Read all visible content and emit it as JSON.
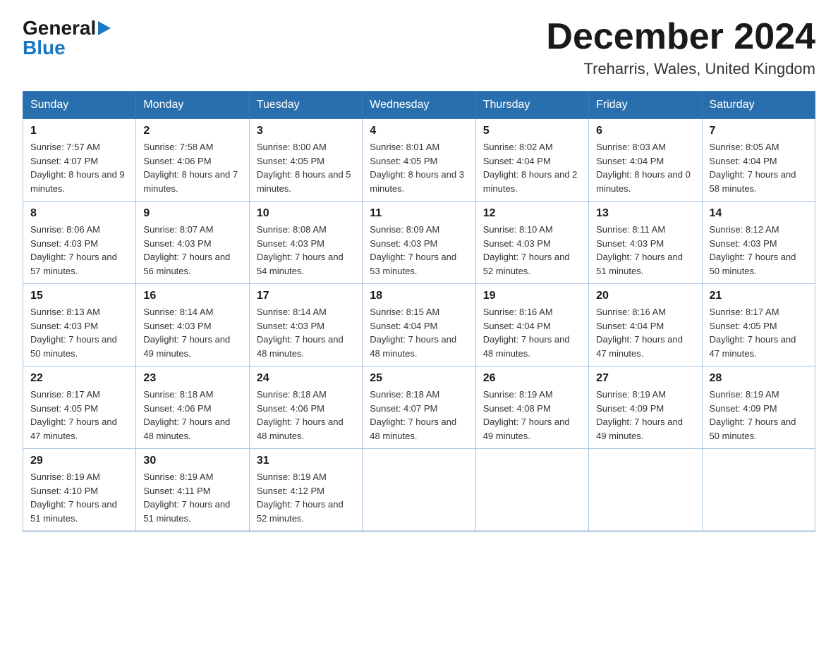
{
  "header": {
    "logo_general": "General",
    "logo_triangle": "▶",
    "logo_blue": "Blue",
    "month_title": "December 2024",
    "location": "Treharris, Wales, United Kingdom"
  },
  "weekdays": [
    "Sunday",
    "Monday",
    "Tuesday",
    "Wednesday",
    "Thursday",
    "Friday",
    "Saturday"
  ],
  "weeks": [
    [
      {
        "day": "1",
        "sunrise": "7:57 AM",
        "sunset": "4:07 PM",
        "daylight": "8 hours and 9 minutes."
      },
      {
        "day": "2",
        "sunrise": "7:58 AM",
        "sunset": "4:06 PM",
        "daylight": "8 hours and 7 minutes."
      },
      {
        "day": "3",
        "sunrise": "8:00 AM",
        "sunset": "4:05 PM",
        "daylight": "8 hours and 5 minutes."
      },
      {
        "day": "4",
        "sunrise": "8:01 AM",
        "sunset": "4:05 PM",
        "daylight": "8 hours and 3 minutes."
      },
      {
        "day": "5",
        "sunrise": "8:02 AM",
        "sunset": "4:04 PM",
        "daylight": "8 hours and 2 minutes."
      },
      {
        "day": "6",
        "sunrise": "8:03 AM",
        "sunset": "4:04 PM",
        "daylight": "8 hours and 0 minutes."
      },
      {
        "day": "7",
        "sunrise": "8:05 AM",
        "sunset": "4:04 PM",
        "daylight": "7 hours and 58 minutes."
      }
    ],
    [
      {
        "day": "8",
        "sunrise": "8:06 AM",
        "sunset": "4:03 PM",
        "daylight": "7 hours and 57 minutes."
      },
      {
        "day": "9",
        "sunrise": "8:07 AM",
        "sunset": "4:03 PM",
        "daylight": "7 hours and 56 minutes."
      },
      {
        "day": "10",
        "sunrise": "8:08 AM",
        "sunset": "4:03 PM",
        "daylight": "7 hours and 54 minutes."
      },
      {
        "day": "11",
        "sunrise": "8:09 AM",
        "sunset": "4:03 PM",
        "daylight": "7 hours and 53 minutes."
      },
      {
        "day": "12",
        "sunrise": "8:10 AM",
        "sunset": "4:03 PM",
        "daylight": "7 hours and 52 minutes."
      },
      {
        "day": "13",
        "sunrise": "8:11 AM",
        "sunset": "4:03 PM",
        "daylight": "7 hours and 51 minutes."
      },
      {
        "day": "14",
        "sunrise": "8:12 AM",
        "sunset": "4:03 PM",
        "daylight": "7 hours and 50 minutes."
      }
    ],
    [
      {
        "day": "15",
        "sunrise": "8:13 AM",
        "sunset": "4:03 PM",
        "daylight": "7 hours and 50 minutes."
      },
      {
        "day": "16",
        "sunrise": "8:14 AM",
        "sunset": "4:03 PM",
        "daylight": "7 hours and 49 minutes."
      },
      {
        "day": "17",
        "sunrise": "8:14 AM",
        "sunset": "4:03 PM",
        "daylight": "7 hours and 48 minutes."
      },
      {
        "day": "18",
        "sunrise": "8:15 AM",
        "sunset": "4:04 PM",
        "daylight": "7 hours and 48 minutes."
      },
      {
        "day": "19",
        "sunrise": "8:16 AM",
        "sunset": "4:04 PM",
        "daylight": "7 hours and 48 minutes."
      },
      {
        "day": "20",
        "sunrise": "8:16 AM",
        "sunset": "4:04 PM",
        "daylight": "7 hours and 47 minutes."
      },
      {
        "day": "21",
        "sunrise": "8:17 AM",
        "sunset": "4:05 PM",
        "daylight": "7 hours and 47 minutes."
      }
    ],
    [
      {
        "day": "22",
        "sunrise": "8:17 AM",
        "sunset": "4:05 PM",
        "daylight": "7 hours and 47 minutes."
      },
      {
        "day": "23",
        "sunrise": "8:18 AM",
        "sunset": "4:06 PM",
        "daylight": "7 hours and 48 minutes."
      },
      {
        "day": "24",
        "sunrise": "8:18 AM",
        "sunset": "4:06 PM",
        "daylight": "7 hours and 48 minutes."
      },
      {
        "day": "25",
        "sunrise": "8:18 AM",
        "sunset": "4:07 PM",
        "daylight": "7 hours and 48 minutes."
      },
      {
        "day": "26",
        "sunrise": "8:19 AM",
        "sunset": "4:08 PM",
        "daylight": "7 hours and 49 minutes."
      },
      {
        "day": "27",
        "sunrise": "8:19 AM",
        "sunset": "4:09 PM",
        "daylight": "7 hours and 49 minutes."
      },
      {
        "day": "28",
        "sunrise": "8:19 AM",
        "sunset": "4:09 PM",
        "daylight": "7 hours and 50 minutes."
      }
    ],
    [
      {
        "day": "29",
        "sunrise": "8:19 AM",
        "sunset": "4:10 PM",
        "daylight": "7 hours and 51 minutes."
      },
      {
        "day": "30",
        "sunrise": "8:19 AM",
        "sunset": "4:11 PM",
        "daylight": "7 hours and 51 minutes."
      },
      {
        "day": "31",
        "sunrise": "8:19 AM",
        "sunset": "4:12 PM",
        "daylight": "7 hours and 52 minutes."
      },
      null,
      null,
      null,
      null
    ]
  ]
}
